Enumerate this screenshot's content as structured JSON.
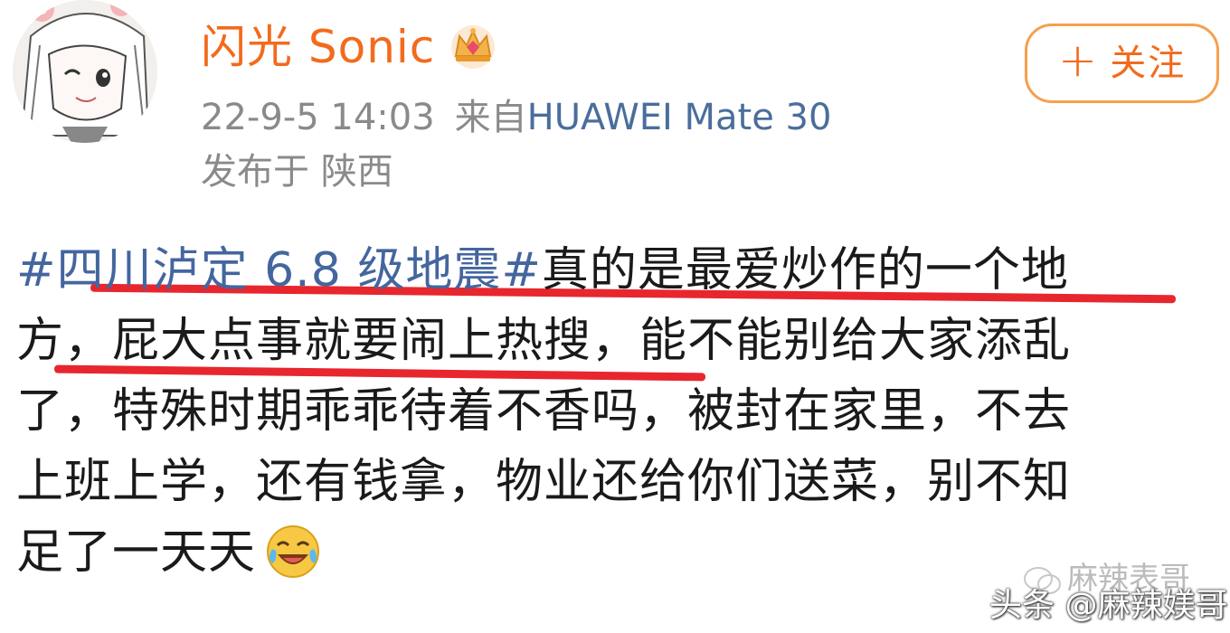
{
  "user": {
    "name": "闪光 Sonic",
    "badge_icon": "crown-icon",
    "avatar_icon": "anime-avatar"
  },
  "follow_button": {
    "plus": "+",
    "label": "关注"
  },
  "meta": {
    "time": "22-9-5 14:03",
    "source_prefix": "来自",
    "source_device": "HUAWEI Mate 30",
    "location": "发布于 陕西"
  },
  "post": {
    "topic": "#四川泸定 6.8 级地震#",
    "lines": [
      "真的是最爱炒作的一个地",
      "方，屁大点事就要闹上热搜，能不能别给大家添乱",
      "了，特殊时期乖乖待着不香吗，被封在家里，不去",
      "上班上学，还有钱拿，物业还给你们送菜，别不知",
      "足了一天天"
    ],
    "emoji": "laughing-crying-emoji"
  },
  "watermark": {
    "top": "麻辣表哥",
    "bottom": "头条 @麻辣媄哥"
  },
  "colors": {
    "username": "#f26b1d",
    "follow_border": "#f5a04f",
    "topic": "#44669e",
    "device": "#4a6e9c",
    "meta": "#8a8a8a",
    "underline": "#e8262d"
  }
}
